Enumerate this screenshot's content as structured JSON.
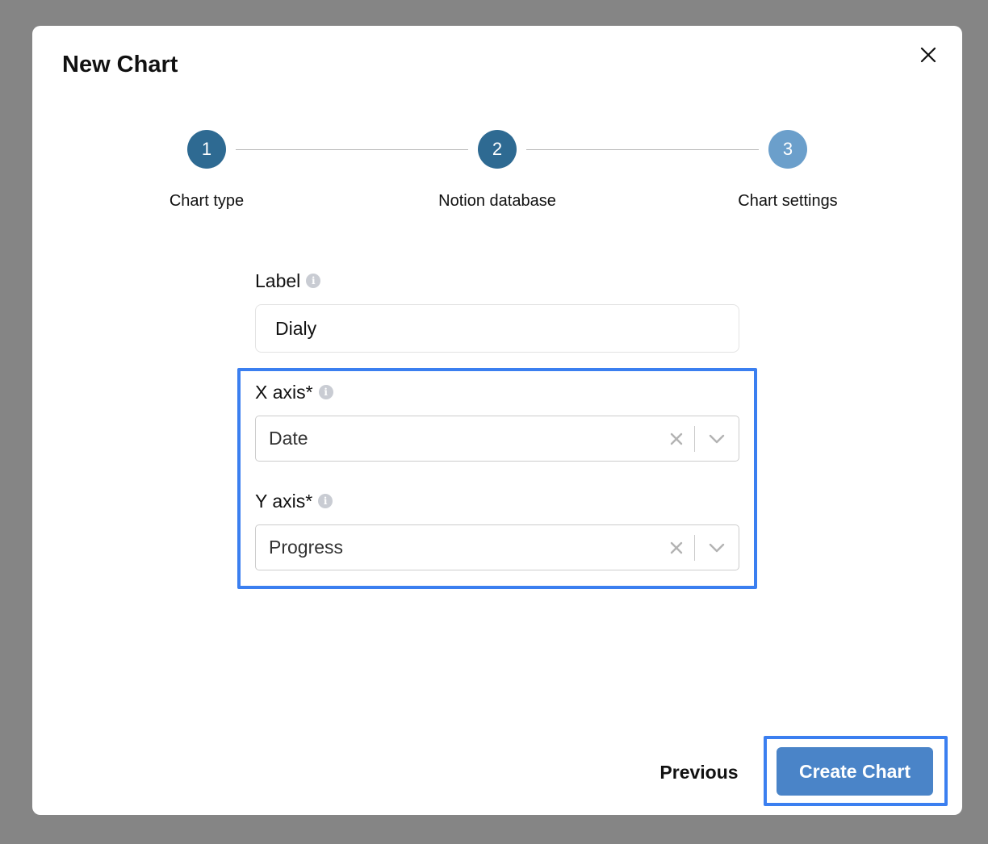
{
  "modal": {
    "title": "New Chart",
    "close_icon": "close-icon"
  },
  "stepper": {
    "steps": [
      {
        "number": "1",
        "label": "Chart type",
        "state": "done"
      },
      {
        "number": "2",
        "label": "Notion database",
        "state": "done"
      },
      {
        "number": "3",
        "label": "Chart settings",
        "state": "current"
      }
    ]
  },
  "form": {
    "label_field": {
      "label": "Label",
      "value": "Dialy",
      "info_icon": "info-icon"
    },
    "x_axis": {
      "label": "X axis*",
      "value": "Date",
      "info_icon": "info-icon"
    },
    "y_axis": {
      "label": "Y axis*",
      "value": "Progress",
      "info_icon": "info-icon"
    }
  },
  "footer": {
    "previous_label": "Previous",
    "create_label": "Create Chart"
  },
  "colors": {
    "overlay": "#858585",
    "step_done": "#2e6a92",
    "step_current": "#6b9fcb",
    "primary_button": "#4a84c8",
    "highlight": "#3b7ff0"
  }
}
